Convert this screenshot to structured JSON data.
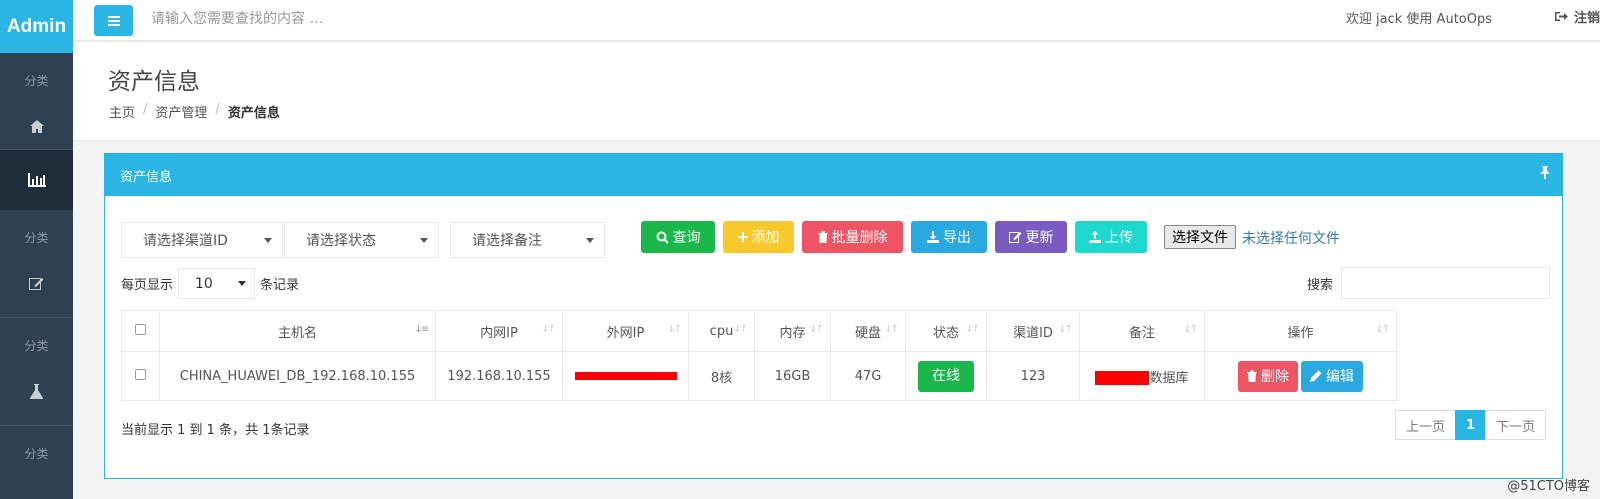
{
  "brand": "Admin",
  "sidebar": {
    "categories": [
      "分类",
      "分类",
      "分类",
      "分类"
    ],
    "icons": [
      "home-icon",
      "bar-chart-icon",
      "edit-icon",
      "flask-icon"
    ]
  },
  "topbar": {
    "search_placeholder": "请输入您需要查找的内容 …",
    "welcome": "欢迎 jack 使用 AutoOps",
    "logout": "注销"
  },
  "heading": {
    "title": "资产信息",
    "breadcrumb": [
      "主页",
      "资产管理",
      "资产信息"
    ]
  },
  "panel": {
    "title": "资产信息",
    "filters": [
      "请选择渠道ID",
      "请选择状态",
      "请选择备注"
    ],
    "buttons": {
      "query": "查询",
      "add": "添加",
      "batch_delete": "批量删除",
      "export": "导出",
      "update": "更新",
      "upload": "上传"
    },
    "file_button": "选择文件",
    "file_status": "未选择任何文件",
    "per_page_prefix": "每页显示",
    "per_page_value": "10",
    "per_page_suffix": "条记录",
    "search_label": "搜索"
  },
  "table": {
    "headers": [
      "主机名",
      "内网IP",
      "外网IP",
      "cpu",
      "内存",
      "硬盘",
      "状态",
      "渠道ID",
      "备注",
      "操作"
    ],
    "rows": [
      {
        "hostname": "CHINA_HUAWEI_DB_192.168.10.155",
        "lan_ip": "192.168.10.155",
        "wan_ip": "",
        "cpu": "8核",
        "memory": "16GB",
        "disk": "47G",
        "status": "在线",
        "channel_id": "123",
        "remark": "数据库",
        "delete": "删除",
        "edit": "编辑"
      }
    ]
  },
  "footer": {
    "info": "当前显示 1 到 1 条，共 1条记录",
    "prev": "上一页",
    "page": "1",
    "next": "下一页"
  },
  "watermark": "@51CTO博客",
  "colors": {
    "brand": "#29b6e4",
    "sidebar": "#2f4050",
    "success": "#1ab84a",
    "danger": "#ed5565",
    "warning": "#f8c92d",
    "purple": "#7a5cc0"
  }
}
